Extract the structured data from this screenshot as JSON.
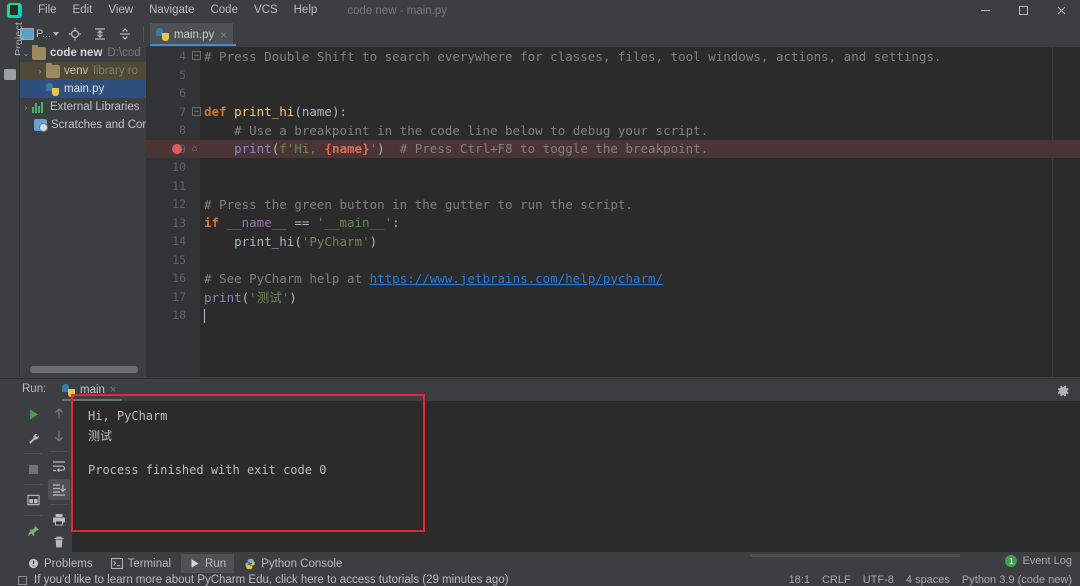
{
  "titlebar": {
    "logo": "pycharm-logo",
    "menus": [
      "File",
      "Edit",
      "View",
      "Navigate",
      "Code",
      "VCS",
      "Help"
    ],
    "window_title": "code new - main.py",
    "controls": [
      "minimize",
      "maximize",
      "close"
    ]
  },
  "toolbar": {
    "project_selector_label": "P...",
    "icons": [
      "locate-icon",
      "collapse-all-icon",
      "expand-icon"
    ]
  },
  "editor_tabs": [
    {
      "label": "main.py",
      "icon": "python-file-icon",
      "active": true,
      "close": "×"
    }
  ],
  "project_panel": {
    "vertical_label": "Project",
    "tree": [
      {
        "arrow": "⌄",
        "icon": "folder-icon",
        "name": "code new",
        "sub": "D:\\cod",
        "state": "expanded",
        "bold": true
      },
      {
        "arrow": "›",
        "icon": "folder-icon",
        "name": "venv",
        "sub": "library ro",
        "state": "collapsed",
        "bold": false,
        "highlight": true
      },
      {
        "arrow": "",
        "icon": "python-file-icon",
        "name": "main.py",
        "sub": "",
        "state": "leaf",
        "bold": false,
        "selected": true
      },
      {
        "arrow": "›",
        "icon": "external-libraries-icon",
        "name": "External Libraries",
        "sub": "",
        "state": "collapsed",
        "bold": false
      },
      {
        "arrow": "",
        "icon": "scratches-icon",
        "name": "Scratches and Cor",
        "sub": "",
        "state": "leaf",
        "bold": false
      }
    ]
  },
  "code": {
    "first_line_number": 4,
    "lines": [
      {
        "n": 4,
        "fold": "minus",
        "tokens": [
          {
            "t": "# Press Double Shift to search everywhere for classes, files, tool windows, actions, and settings.",
            "c": "tk-com"
          }
        ]
      },
      {
        "n": 5,
        "tokens": []
      },
      {
        "n": 6,
        "tokens": []
      },
      {
        "n": 7,
        "fold": "minus",
        "tokens": [
          {
            "t": "def ",
            "c": "tk-kw"
          },
          {
            "t": "print_hi",
            "c": "tk-fn"
          },
          {
            "t": "(name):",
            "c": "tk-id"
          }
        ]
      },
      {
        "n": 8,
        "tokens": [
          {
            "t": "    # Use a breakpoint in the code line below to debug your script.",
            "c": "tk-com"
          }
        ]
      },
      {
        "n": 9,
        "breakpoint": true,
        "fold": "arrow",
        "tokens": [
          {
            "t": "    ",
            "c": "tk-id"
          },
          {
            "t": "print",
            "c": "tk-builtin"
          },
          {
            "t": "(",
            "c": "tk-id"
          },
          {
            "t": "f'Hi, ",
            "c": "tk-str"
          },
          {
            "t": "{name}",
            "c": "tk-brace"
          },
          {
            "t": "'",
            "c": "tk-str"
          },
          {
            "t": ")",
            "c": "tk-id"
          },
          {
            "t": "  # Press Ctrl+F8 to toggle the breakpoint.",
            "c": "tk-com"
          }
        ]
      },
      {
        "n": 10,
        "tokens": []
      },
      {
        "n": 11,
        "tokens": []
      },
      {
        "n": 12,
        "tokens": [
          {
            "t": "# Press the green button in the gutter to run the script.",
            "c": "tk-com"
          }
        ]
      },
      {
        "n": 13,
        "tokens": [
          {
            "t": "if ",
            "c": "tk-kw"
          },
          {
            "t": "__name__",
            "c": "tk-var"
          },
          {
            "t": " == ",
            "c": "tk-id"
          },
          {
            "t": "'__main__'",
            "c": "tk-str"
          },
          {
            "t": ":",
            "c": "tk-id"
          }
        ]
      },
      {
        "n": 14,
        "tokens": [
          {
            "t": "    ",
            "c": "tk-id"
          },
          {
            "t": "print_hi",
            "c": "tk-id"
          },
          {
            "t": "(",
            "c": "tk-id"
          },
          {
            "t": "'PyCharm'",
            "c": "tk-str"
          },
          {
            "t": ")",
            "c": "tk-id"
          }
        ]
      },
      {
        "n": 15,
        "tokens": []
      },
      {
        "n": 16,
        "tokens": [
          {
            "t": "# See PyCharm help at ",
            "c": "tk-com"
          },
          {
            "t": "https://www.jetbrains.com/help/pycharm/",
            "c": "tk-link"
          }
        ]
      },
      {
        "n": 17,
        "tokens": [
          {
            "t": "print",
            "c": "tk-builtin"
          },
          {
            "t": "(",
            "c": "tk-id"
          },
          {
            "t": "'测试'",
            "c": "tk-str"
          },
          {
            "t": ")",
            "c": "tk-id"
          }
        ]
      },
      {
        "n": 18,
        "caret": true,
        "tokens": []
      }
    ]
  },
  "run_panel": {
    "label": "Run:",
    "tab": {
      "label": "main",
      "icon": "python-file-icon",
      "close": "×"
    },
    "gear": "settings-gear-icon",
    "left_icons": [
      "run-icon",
      "wrench-icon",
      "stop-icon",
      "layout-icon",
      "pin-icon"
    ],
    "right_icons": [
      "arrow-up-icon",
      "arrow-down-icon",
      "soft-wrap-icon",
      "scroll-to-end-icon",
      "print-icon",
      "trash-icon"
    ],
    "console_output": [
      "Hi, PyCharm",
      "测试",
      "",
      "Process finished with exit code 0"
    ],
    "annotation_color": "#e02b36"
  },
  "statusbar": {
    "tools": [
      {
        "label": "Problems",
        "icon": "problems-icon",
        "active": false
      },
      {
        "label": "Terminal",
        "icon": "terminal-icon",
        "active": false
      },
      {
        "label": "Run",
        "icon": "run-icon",
        "active": true
      },
      {
        "label": "Python Console",
        "icon": "python-console-icon",
        "active": false
      }
    ],
    "hint": "If you'd like to learn more about PyCharm Edu, click here to access tutorials (29 minutes ago)",
    "event_log": {
      "count": "1",
      "label": "Event Log"
    },
    "right": [
      "18:1",
      "CRLF",
      "UTF-8",
      "4 spaces",
      "Python 3.9 (code new)"
    ]
  },
  "colors": {
    "chrome": "#3c3f41",
    "editor_bg": "#2b2b2b",
    "accent_blue": "#4a88c7",
    "breakpoint_red": "#db5c5c",
    "annotation_red": "#e02b36",
    "run_green": "#499c54"
  }
}
